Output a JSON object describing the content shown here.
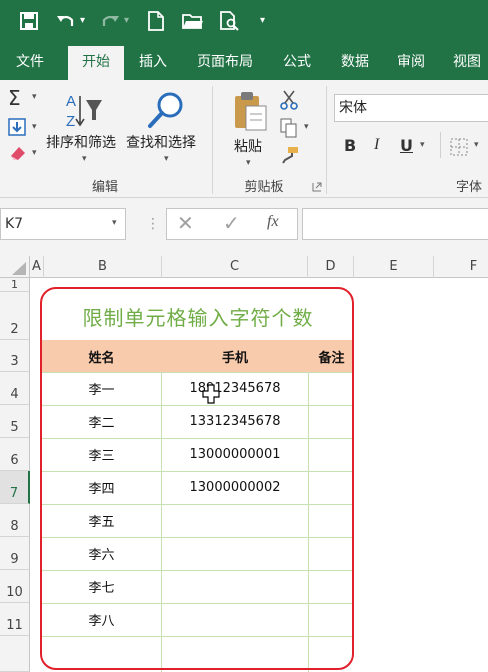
{
  "quick_access": {
    "redo_caret": "▾",
    "more": "▾"
  },
  "tabs": [
    "文件",
    "开始",
    "插入",
    "页面布局",
    "公式",
    "数据",
    "审阅",
    "视图"
  ],
  "ribbon": {
    "sort_filter_label": "排序和筛选",
    "find_select_label": "查找和选择",
    "editing_group": "编辑",
    "paste_label": "粘贴",
    "clipboard_group": "剪贴板",
    "font_name": "宋体",
    "font_group": "字体",
    "bold": "B",
    "italic": "I",
    "underline": "U"
  },
  "formula_bar": {
    "name_box": "K7",
    "fx": "fx"
  },
  "columns": [
    "A",
    "B",
    "C",
    "D",
    "E",
    "F"
  ],
  "rows": [
    "1",
    "2",
    "3",
    "4",
    "5",
    "6",
    "7",
    "8",
    "9",
    "10",
    "11"
  ],
  "selected_row": "7",
  "sheet": {
    "title": "限制单元格输入字符个数",
    "headers": {
      "name": "姓名",
      "phone": "手机",
      "note": "备注"
    },
    "names": [
      "李一",
      "李二",
      "李三",
      "李四",
      "李五",
      "李六",
      "李七",
      "李八"
    ],
    "phones": [
      "18912345678",
      "13312345678",
      "13000000001",
      "13000000002"
    ]
  },
  "colors": {
    "excel_green": "#217346",
    "header_fill": "#f8cbad",
    "title_green": "#70ad47",
    "callout_red": "#e0202a"
  }
}
